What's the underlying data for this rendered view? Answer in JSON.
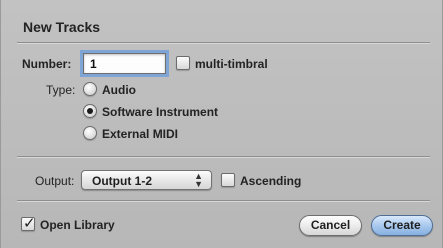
{
  "dialog": {
    "title": "New Tracks"
  },
  "number": {
    "label": "Number:",
    "value": "1",
    "multitimbral_label": "multi-timbral",
    "multitimbral_checked": false
  },
  "type": {
    "label": "Type:",
    "options": [
      {
        "label": "Audio",
        "selected": false
      },
      {
        "label": "Software Instrument",
        "selected": true
      },
      {
        "label": "External MIDI",
        "selected": false
      }
    ]
  },
  "output": {
    "label": "Output:",
    "selected": "Output 1-2",
    "ascending_label": "Ascending",
    "ascending_checked": false
  },
  "open_library": {
    "label": "Open Library",
    "checked": true
  },
  "buttons": {
    "cancel": "Cancel",
    "create": "Create"
  },
  "colors": {
    "focus_ring": "#7fa4d6",
    "default_button": "#a9c9ee",
    "dialog_bg": "#bcbcbc"
  }
}
